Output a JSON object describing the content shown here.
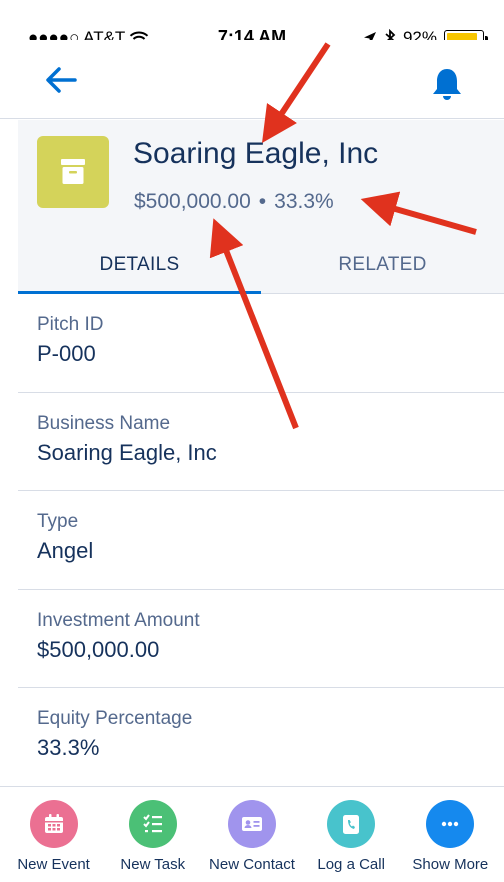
{
  "status_bar": {
    "carrier": "●●●●○ AT&T",
    "time": "7:14 AM",
    "battery": "92%",
    "battery_level": 0.92
  },
  "nav": {
    "back_icon": "arrow-left-icon",
    "notifications_icon": "bell-icon"
  },
  "record": {
    "title": "Soaring Eagle, Inc",
    "amount": "$500,000.00",
    "separator": "•",
    "percentage": "33.3%",
    "icon": "archive-box-icon",
    "icon_color": "#d4d35a"
  },
  "tabs": [
    {
      "label": "DETAILS",
      "active": true
    },
    {
      "label": "RELATED",
      "active": false
    }
  ],
  "fields": [
    {
      "label": "Pitch ID",
      "value": "P-000"
    },
    {
      "label": "Business Name",
      "value": "Soaring Eagle, Inc"
    },
    {
      "label": "Type",
      "value": "Angel"
    },
    {
      "label": "Investment Amount",
      "value": "$500,000.00"
    },
    {
      "label": "Equity Percentage",
      "value": "33.3%"
    }
  ],
  "actions": [
    {
      "label": "New Event",
      "icon": "calendar-icon",
      "color": "#eb7092"
    },
    {
      "label": "New Task",
      "icon": "task-list-icon",
      "color": "#4bc076"
    },
    {
      "label": "New Contact",
      "icon": "contact-card-icon",
      "color": "#a094ed"
    },
    {
      "label": "Log a Call",
      "icon": "phone-log-icon",
      "color": "#48c3cc"
    },
    {
      "label": "Show More",
      "icon": "more-icon",
      "color": "#1589ee"
    }
  ],
  "colors": {
    "accent": "#0070d2",
    "annotation_arrow": "#e0321e"
  }
}
